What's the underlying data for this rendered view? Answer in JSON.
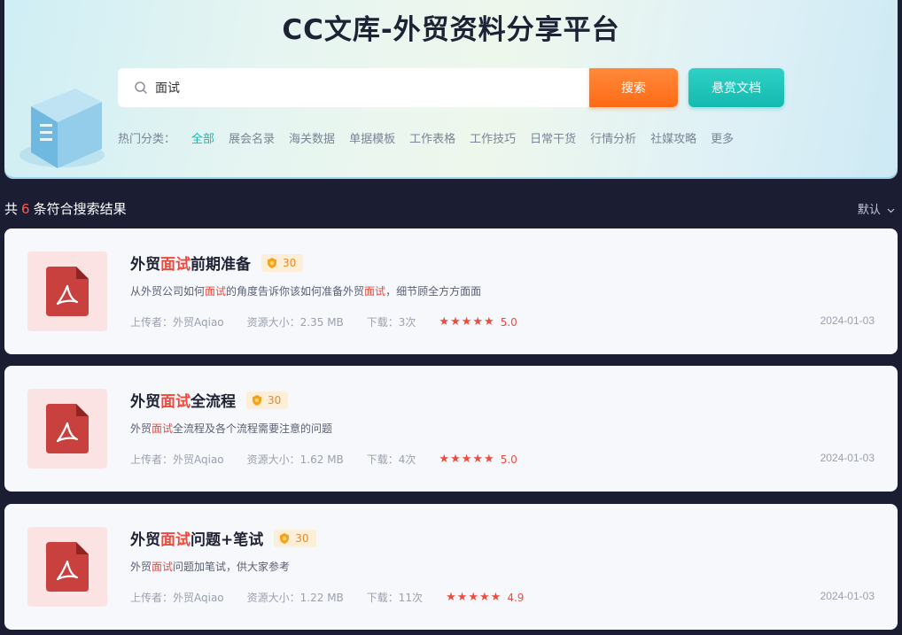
{
  "header": {
    "title": "CC文库-外贸资料分享平台"
  },
  "search": {
    "value": "面试",
    "button_label": "搜索",
    "reward_label": "悬赏文档"
  },
  "categories": {
    "label": "热门分类：",
    "items": [
      "全部",
      "展会名录",
      "海关数据",
      "单据模板",
      "工作表格",
      "工作技巧",
      "日常干货",
      "行情分析",
      "社媒攻略",
      "更多"
    ],
    "active": "全部"
  },
  "results": {
    "prefix": "共",
    "count": "6",
    "suffix": "条符合搜索结果",
    "sort_label": "默认"
  },
  "colors": {
    "accent_teal": "#19b7b0",
    "accent_orange": "#ff6a16",
    "highlight_red": "#ec4a3c"
  },
  "items": [
    {
      "title_pre": "外贸",
      "title_hl": "面试",
      "title_post": "前期准备",
      "coins": "30",
      "desc_pre": "从外贸公司如何",
      "desc_hl": "面试",
      "desc_mid": "的角度告诉你该如何准备外贸",
      "desc_hl2": "面试",
      "desc_post": "，细节顾全方方面面",
      "uploader": "上传者：外贸Aqiao",
      "size": "资源大小：2.35 MB",
      "downloads": "下载：3次",
      "rating": "5.0",
      "stars": 5,
      "date": "2024-01-03",
      "icon": "pdf-icon"
    },
    {
      "title_pre": "外贸",
      "title_hl": "面试",
      "title_post": "全流程",
      "coins": "30",
      "desc_pre": "外贸",
      "desc_hl": "面试",
      "desc_mid": "全流程及各个流程需要注意的问题",
      "desc_hl2": "",
      "desc_post": "",
      "uploader": "上传者：外贸Aqiao",
      "size": "资源大小：1.62 MB",
      "downloads": "下载：4次",
      "rating": "5.0",
      "stars": 5,
      "date": "2024-01-03",
      "icon": "pdf-icon"
    },
    {
      "title_pre": "外贸",
      "title_hl": "面试",
      "title_post": "问题+笔试",
      "coins": "30",
      "desc_pre": "外贸",
      "desc_hl": "面试",
      "desc_mid": "问题加笔试，供大家参考",
      "desc_hl2": "",
      "desc_post": "",
      "uploader": "上传者：外贸Aqiao",
      "size": "资源大小：1.22 MB",
      "downloads": "下载：11次",
      "rating": "4.9",
      "stars": 5,
      "date": "2024-01-03",
      "icon": "pdf-icon"
    }
  ]
}
